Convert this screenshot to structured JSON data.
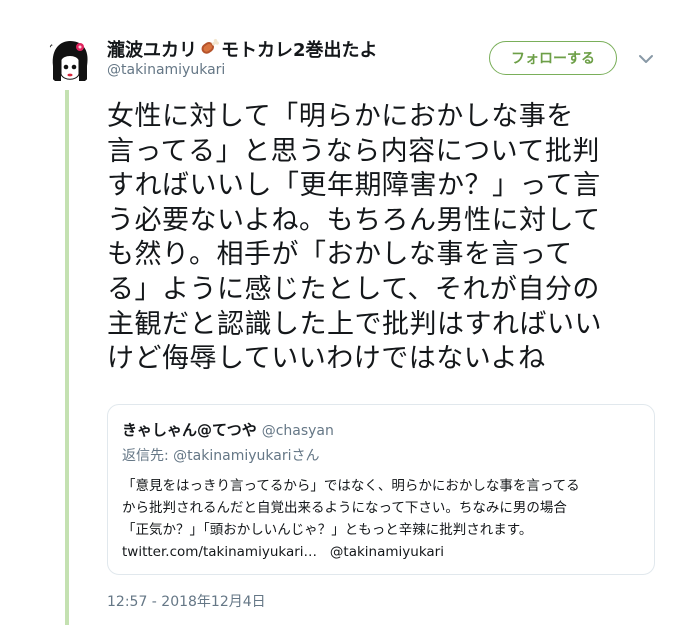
{
  "header": {
    "display_name_part1": "瀧波ユカリ",
    "display_name_part2": "モトカレ2巻出たよ",
    "name_emoji": "meat-on-bone-icon",
    "handle": "@takinamiyukari",
    "follow_label": "フォローする",
    "menu_icon": "chevron-down-icon"
  },
  "tweet": {
    "text": "女性に対して「明らかにおかしな事を\n言ってる」と思うなら内容について批判\nすればいいし「更年期障害か？」って言\nう必要ないよね。もちろん男性に対して\nも然り。相手が「おかしな事を言って\nる」ように感じたとして、それが自分の\n主観だと認識した上で批判はすればいい\nけど侮辱していいわけではないよね",
    "timestamp": "12:57 - 2018年12月4日"
  },
  "quote": {
    "name": "きゃしゃん@てつや",
    "handle": "@chasyan",
    "reply_prefix": "返信先: ",
    "reply_mention": "@takinamiyukari",
    "reply_suffix": "さん",
    "body": "「意見をはっきり言ってるから」ではなく、明らかにおかしな事を言ってる\nから批判されるんだと自覚出来るようになって下さい。ちなみに男の場合\n「正気か？」「頭おかしいんじゃ？」ともっと辛辣に批判されます。\n",
    "link": "twitter.com/takinamiyukari…",
    "mention": "@takinamiyukari"
  },
  "colors": {
    "thread_line": "#c4e1b1",
    "follow_border": "#7aaf5a",
    "follow_text": "#6d9f47",
    "muted_text": "#657786",
    "card_border": "#e1e8ed"
  }
}
